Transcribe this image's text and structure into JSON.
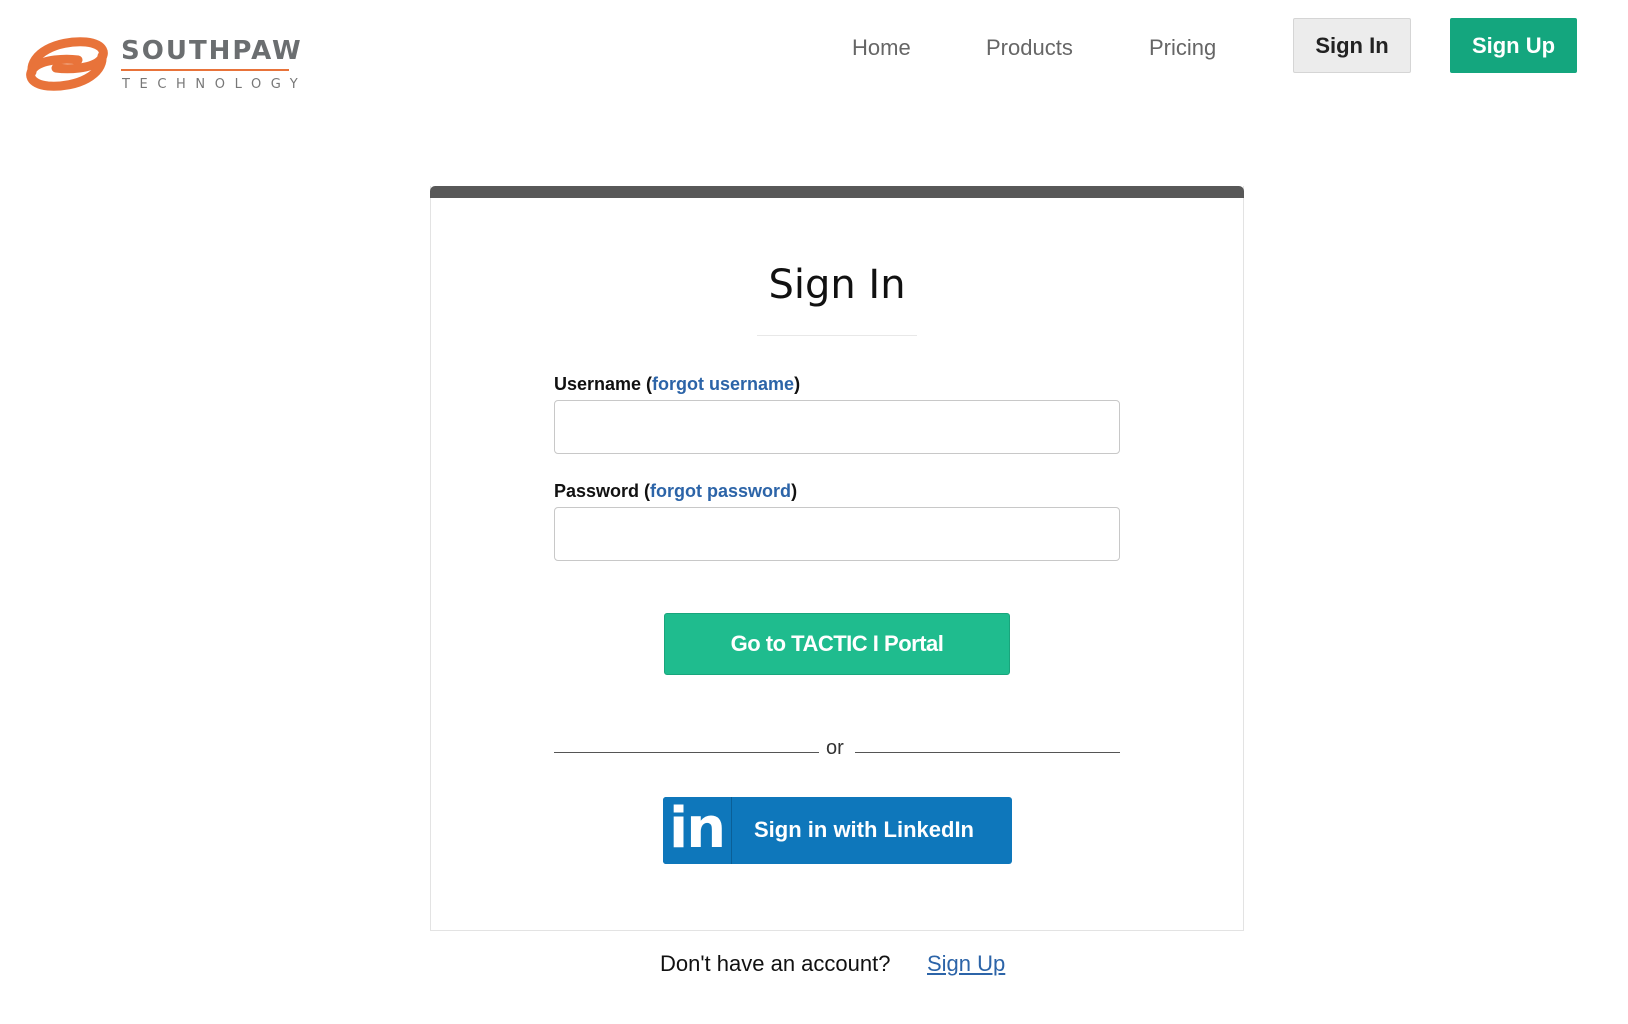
{
  "brand": {
    "name": "SOUTHPAW",
    "tagline": "TECHNOLOGY",
    "colors": {
      "orange": "#e8733a",
      "gray": "#6b6e70"
    }
  },
  "nav": {
    "links": [
      "Home",
      "Products",
      "Pricing"
    ],
    "signin_label": "Sign In",
    "signup_label": "Sign Up"
  },
  "card": {
    "title": "Sign In",
    "username": {
      "label": "Username",
      "paren_open": " (",
      "forgot_label": "forgot username",
      "paren_close": ")",
      "value": "",
      "placeholder": ""
    },
    "password": {
      "label": "Password",
      "paren_open": " (",
      "forgot_label": "forgot password",
      "paren_close": ")",
      "value": "",
      "placeholder": ""
    },
    "submit_label": "Go to TACTIC I Portal",
    "divider_text": "or",
    "linkedin": {
      "logo_text": "in",
      "label": "Sign in with LinkedIn"
    }
  },
  "footer": {
    "question": "Don't have an account?",
    "signup_link": "Sign Up"
  },
  "colors": {
    "accent_green": "#1fbc8e",
    "signup_green": "#14a67e",
    "linkedin_blue": "#0e77bb",
    "link_blue": "#2c64a8",
    "card_topbar": "#585858"
  }
}
